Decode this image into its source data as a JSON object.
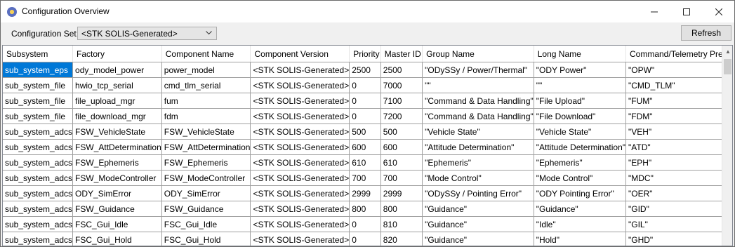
{
  "window": {
    "title": "Configuration Overview"
  },
  "toolbar": {
    "config_set_label": "Configuration Set:",
    "config_set_value": "<STK SOLIS-Generated>",
    "refresh_label": "Refresh"
  },
  "table": {
    "columns": [
      "Subsystem",
      "Factory",
      "Component Name",
      "Component Version",
      "Priority",
      "Master ID",
      "Group Name",
      "Long Name",
      "Command/Telemetry Prefix"
    ],
    "rows": [
      [
        "sub_system_eps",
        "ody_model_power",
        "power_model",
        "<STK SOLIS-Generated>",
        "2500",
        "2500",
        "\"ODySSy / Power/Thermal\"",
        "\"ODY Power\"",
        "\"OPW\""
      ],
      [
        "sub_system_file",
        "hwio_tcp_serial",
        "cmd_tlm_serial",
        "<STK SOLIS-Generated>",
        "0",
        "7000",
        "\"\"",
        "\"\"",
        "\"CMD_TLM\""
      ],
      [
        "sub_system_file",
        "file_upload_mgr",
        "fum",
        "<STK SOLIS-Generated>",
        "0",
        "7100",
        "\"Command & Data Handling\"",
        "\"File Upload\"",
        "\"FUM\""
      ],
      [
        "sub_system_file",
        "file_download_mgr",
        "fdm",
        "<STK SOLIS-Generated>",
        "0",
        "7200",
        "\"Command & Data Handling\"",
        "\"File Download\"",
        "\"FDM\""
      ],
      [
        "sub_system_adcs",
        "FSW_VehicleState",
        "FSW_VehicleState",
        "<STK SOLIS-Generated>",
        "500",
        "500",
        "\"Vehicle State\"",
        "\"Vehicle State\"",
        "\"VEH\""
      ],
      [
        "sub_system_adcs",
        "FSW_AttDetermination",
        "FSW_AttDetermination",
        "<STK SOLIS-Generated>",
        "600",
        "600",
        "\"Attitude Determination\"",
        "\"Attitude Determination\"",
        "\"ATD\""
      ],
      [
        "sub_system_adcs",
        "FSW_Ephemeris",
        "FSW_Ephemeris",
        "<STK SOLIS-Generated>",
        "610",
        "610",
        "\"Ephemeris\"",
        "\"Ephemeris\"",
        "\"EPH\""
      ],
      [
        "sub_system_adcs",
        "FSW_ModeController",
        "FSW_ModeController",
        "<STK SOLIS-Generated>",
        "700",
        "700",
        "\"Mode Control\"",
        "\"Mode Control\"",
        "\"MDC\""
      ],
      [
        "sub_system_adcs",
        "ODY_SimError",
        "ODY_SimError",
        "<STK SOLIS-Generated>",
        "2999",
        "2999",
        "\"ODySSy / Pointing Error\"",
        "\"ODY Pointing Error\"",
        "\"OER\""
      ],
      [
        "sub_system_adcs",
        "FSW_Guidance",
        "FSW_Guidance",
        "<STK SOLIS-Generated>",
        "800",
        "800",
        "\"Guidance\"",
        "\"Guidance\"",
        "\"GID\""
      ],
      [
        "sub_system_adcs",
        "FSC_Gui_Idle",
        "FSC_Gui_Idle",
        "<STK SOLIS-Generated>",
        "0",
        "810",
        "\"Guidance\"",
        "\"Idle\"",
        "\"GIL\""
      ],
      [
        "sub_system_adcs",
        "FSC_Gui_Hold",
        "FSC_Gui_Hold",
        "<STK SOLIS-Generated>",
        "0",
        "820",
        "\"Guidance\"",
        "\"Hold\"",
        "\"GHD\""
      ]
    ],
    "selected_cell": "row-0-col-0"
  },
  "colors": {
    "selection": "#0078d7",
    "window_bg": "#f0f0f0"
  },
  "icons": {
    "app": "config-globe-icon",
    "minimize": "minimize-icon",
    "maximize": "maximize-icon",
    "close": "close-icon",
    "dropdown": "chevron-down-icon",
    "scroll_up": "scroll-up-arrow-icon"
  }
}
